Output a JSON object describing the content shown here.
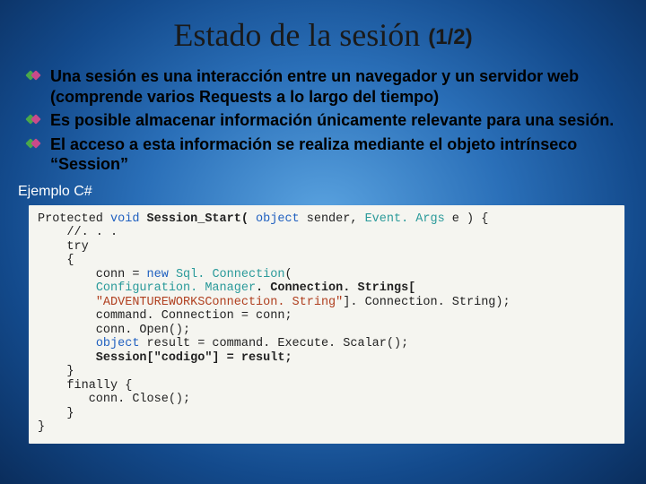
{
  "title": "Estado de la sesión",
  "page_indicator": "(1/2)",
  "bullets": [
    "Una sesión es una interacción entre un navegador y un servidor web (comprende varios Requests a lo largo del tiempo)",
    "Es posible almacenar información únicamente relevante para una sesión.",
    "El acceso a esta información se realiza mediante el objeto intrínseco “Session”"
  ],
  "example_label": "Ejemplo C#",
  "code": {
    "l1a": "Protected ",
    "l1b": "void",
    "l1c": " Session_Start( ",
    "l1d": "object",
    "l1e": " sender, ",
    "l1f": "Event. Args",
    "l1g": " e ) {",
    "l2": "    //. . .",
    "l3": "    try",
    "l4": "    {",
    "l5a": "        conn = ",
    "l5b": "new",
    "l5c": " ",
    "l5d": "Sql. Connection",
    "l5e": "(",
    "l6a": "        ",
    "l6b": "Configuration. Manager",
    "l6c": ". Connection. Strings[",
    "l7a": "        ",
    "l7b": "\"ADVENTUREWORKSConnection. String\"",
    "l7c": "]. Connection. String);",
    "l8": "        command. Connection = conn;",
    "l9": "        conn. Open();",
    "l10a": "        ",
    "l10b": "object",
    "l10c": " result = command. Execute. Scalar();",
    "l11": "        Session[\"codigo\"] = result;",
    "l12": "    }",
    "l13": "    finally {",
    "l14": "       conn. Close();",
    "l15": "    }",
    "l16": "}"
  }
}
